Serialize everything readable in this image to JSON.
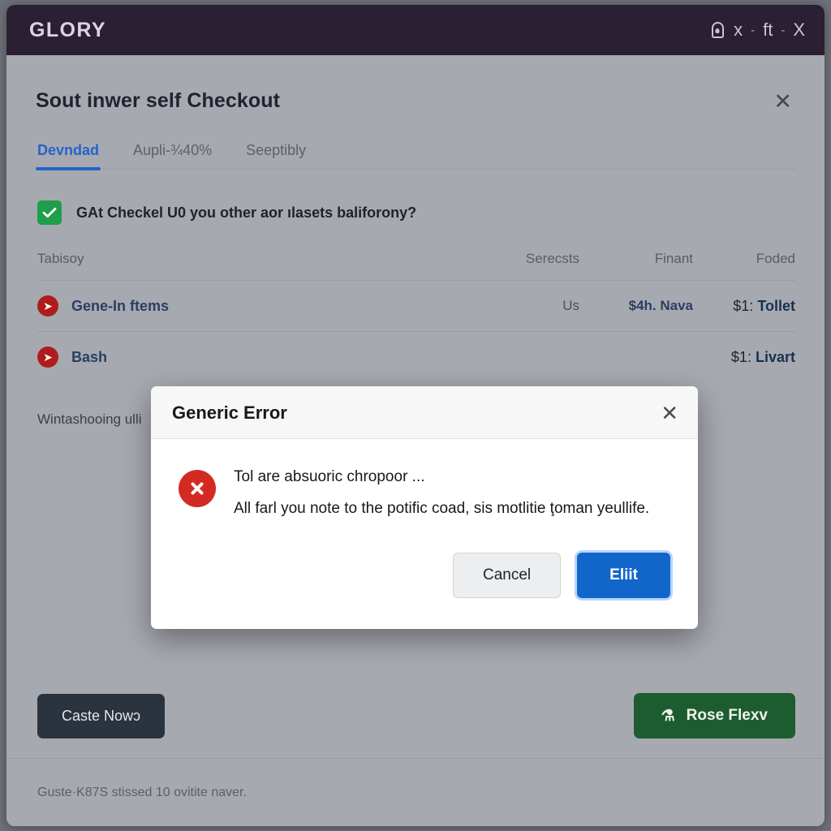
{
  "titlebar": {
    "brand": "GLORY",
    "lock_icon": "lock-icon",
    "minimize_label": "x",
    "sep1": "-",
    "maximize_label": "ft",
    "sep2": "-",
    "close_label": "X"
  },
  "page": {
    "title": "Sout inwer self Checkout",
    "close_label": "✕",
    "tabs": [
      {
        "label": "Devndad",
        "active": true
      },
      {
        "label": "Aupli-¾40%",
        "active": false
      },
      {
        "label": "Seeptibly",
        "active": false
      }
    ],
    "checkbox": {
      "checked": true,
      "label": "GAt Checkel U0 you other aor ılasets baliforony?"
    },
    "table": {
      "headers": [
        "Tabisoy",
        "Serecsts",
        "Finant",
        "Foded"
      ],
      "rows": [
        {
          "bullet": "➤",
          "name": "Gene-In ftems",
          "serecsts": "Us",
          "finant": "$4h. Nava",
          "foded_prefix": "$1:",
          "foded_value": "Tollet"
        },
        {
          "bullet": "➤",
          "name": "Bash",
          "serecsts": "",
          "finant": "",
          "foded_prefix": "$1:",
          "foded_value": "Livart"
        }
      ]
    },
    "note": "Wintashooing ulli",
    "actions": {
      "secondary_label": "Caste Nowɔ",
      "primary_icon": "person-icon",
      "primary_label": "Rose Flexv"
    },
    "statusbar": "Guste·K87S stissed 10 ovitite naver."
  },
  "modal": {
    "title": "Generic Error",
    "close_label": "✕",
    "icon": "error-circle-x-icon",
    "message_main": "Tol are absuoric chropoor ...",
    "message_sub": "All farl you note to the potific coad, sis motlitie ţoman yeullife.",
    "cancel_label": "Cancel",
    "confirm_label": "Eliit"
  },
  "colors": {
    "titlebar_bg": "#2b1f33",
    "page_bg": "#a7a9b1",
    "accent_blue": "#2563c9",
    "primary_button": "#1366c9",
    "success_green": "#1f9e4c",
    "action_green": "#1d5c2e",
    "error_red": "#d32b23",
    "bullet_red": "#b01c1c",
    "dark_button": "#2b333f"
  }
}
